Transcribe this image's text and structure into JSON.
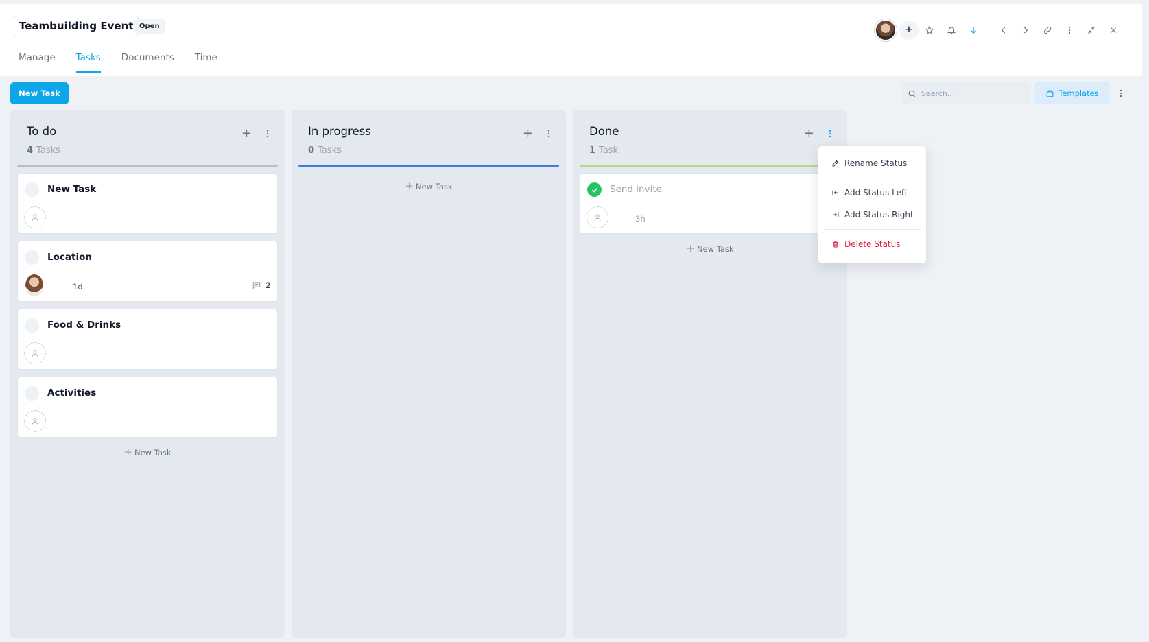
{
  "header": {
    "title": "Teambuilding Event",
    "status_badge": "Open",
    "add_member_label": "+",
    "tabs": [
      {
        "label": "Manage",
        "active": false
      },
      {
        "label": "Tasks",
        "active": true
      },
      {
        "label": "Documents",
        "active": false
      },
      {
        "label": "Time",
        "active": false
      }
    ],
    "icons": [
      "star-icon",
      "bell-icon",
      "arrow-down-icon",
      "chevron-left-icon",
      "chevron-right-icon",
      "link-icon",
      "more-vertical-icon",
      "collapse-icon",
      "close-icon"
    ]
  },
  "toolbar": {
    "new_task_label": "New Task",
    "search_placeholder": "Search...",
    "templates_label": "Templates"
  },
  "columns": [
    {
      "title": "To do",
      "count": "4",
      "count_label": "Tasks",
      "line_color": "#b8bec8",
      "cards": [
        {
          "title": "New Task"
        },
        {
          "title": "Location",
          "duration": "1d",
          "comments": "2"
        },
        {
          "title": "Food & Drinks"
        },
        {
          "title": "Activities"
        }
      ],
      "add_label": "New Task"
    },
    {
      "title": "In progress",
      "count": "0",
      "count_label": "Tasks",
      "line_color": "#3b7dd8",
      "cards": [],
      "add_label": "New Task"
    },
    {
      "title": "Done",
      "count": "1",
      "count_label": "Task",
      "line_color": "#b8d98a",
      "cards": [
        {
          "title": "Send invite",
          "duration": "3h",
          "done": true
        }
      ],
      "add_label": "New Task"
    }
  ],
  "menu": {
    "items": [
      {
        "label": "Rename Status",
        "icon": "pencil-icon"
      },
      {
        "label": "Add Status Left",
        "icon": "arrow-left-bar-icon"
      },
      {
        "label": "Add Status Right",
        "icon": "arrow-right-bar-icon"
      },
      {
        "label": "Delete Status",
        "icon": "trash-icon",
        "color": "#e11d48"
      }
    ]
  },
  "colors": {
    "accent": "#0ea5e9",
    "done_green": "#22c55e",
    "danger": "#e11d48"
  }
}
